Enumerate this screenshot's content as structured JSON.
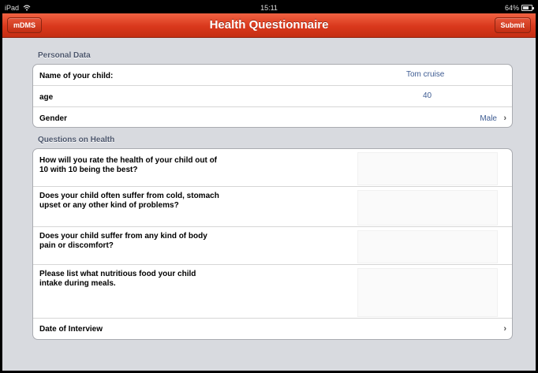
{
  "status_bar": {
    "device": "iPad",
    "time": "15:11",
    "battery": "64%"
  },
  "nav": {
    "back_label": "mDMS",
    "title": "Health Questionnaire",
    "submit_label": "Submit"
  },
  "personal": {
    "header": "Personal Data",
    "name_label": "Name of your child:",
    "name_value": "Tom cruise",
    "age_label": "age",
    "age_value": "40",
    "gender_label": "Gender",
    "gender_value": "Male"
  },
  "health": {
    "header": "Questions on Health",
    "questions": [
      {
        "text": "How will you rate the health of your child out of 10 with 10 being the best?",
        "answer": ""
      },
      {
        "text": "Does your child often suffer from cold, stomach upset or any other kind of problems?",
        "answer": ""
      },
      {
        "text": "Does your child suffer from any kind  of body pain or discomfort?",
        "answer": ""
      },
      {
        "text": "Please list what nutritious food your child intake during meals.",
        "answer": ""
      }
    ],
    "date_label": "Date of Interview"
  },
  "icons": {
    "wifi": "wifi-icon",
    "battery": "battery-icon",
    "chevron": "chevron-right-icon"
  },
  "colors": {
    "nav_red": "#d9381c",
    "value_blue": "#3d5b92",
    "section_text": "#4c566c"
  }
}
